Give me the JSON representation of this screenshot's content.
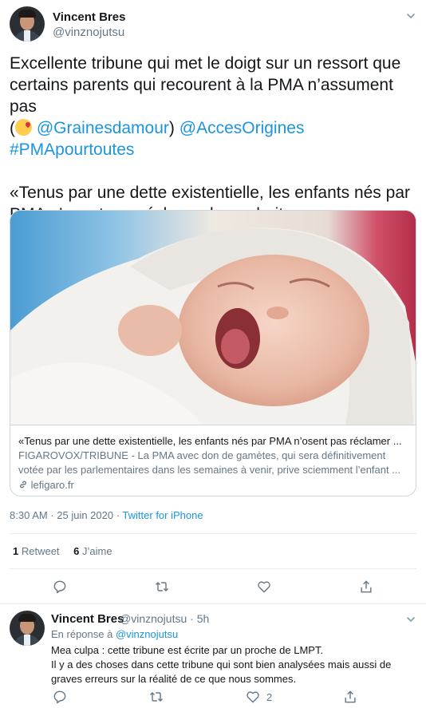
{
  "main_tweet": {
    "author_name": "Vincent Bres",
    "author_handle": "@vinznojutsu",
    "text_line1": "Excellente tribune qui met le doigt sur un ressort que certains parents qui recourent à la PMA n’assument pas",
    "paren_open": "(",
    "mention1": "@Grainesdamour",
    "paren_close": ")",
    "mention2": "@AccesOrigines",
    "hashtag": "#PMApourtoutes",
    "quote": "«Tenus par une dette existentielle, les enfants nés par PMA n’osent pas réclamer leurs droits»",
    "card": {
      "title": "«Tenus par une dette existentielle, les enfants nés par PMA n’osent pas réclamer ...",
      "description": "FIGAROVOX/TRIBUNE - La PMA avec don de gamètes, qui sera définitivement votée par les parlementaires dans les semaines à venir, prive sciemment l’enfant ...",
      "domain": "lefigaro.fr",
      "image_alt": "crying newborn baby wrapped in white towel"
    },
    "time": "8:30 AM · 25 juin 2020 · ",
    "source": "Twitter for iPhone",
    "retweet_count": "1",
    "retweet_label": " Retweet",
    "like_count": "6",
    "like_label": " J’aime"
  },
  "reply_tweet": {
    "author_name": "Vincent Bres",
    "author_handle": "@vinznojutsu · 5h",
    "reply_prefix": "En réponse à ",
    "reply_to": "@vinznojutsu",
    "line1": "Mea culpa : cette tribune est écrite par un proche de LMPT.",
    "line2": "Il y a des choses dans cette tribune qui sont bien analysées mais aussi de graves erreurs sur la réalité de ce que nous sommes.",
    "like_count": "2"
  },
  "colors": {
    "accent": "#1b95e0",
    "muted": "#657786",
    "text": "#14171a",
    "border": "#e6ecf0"
  },
  "icons": [
    "chevron-down-icon",
    "link-icon",
    "reply-icon",
    "retweet-icon",
    "like-icon",
    "share-icon"
  ]
}
